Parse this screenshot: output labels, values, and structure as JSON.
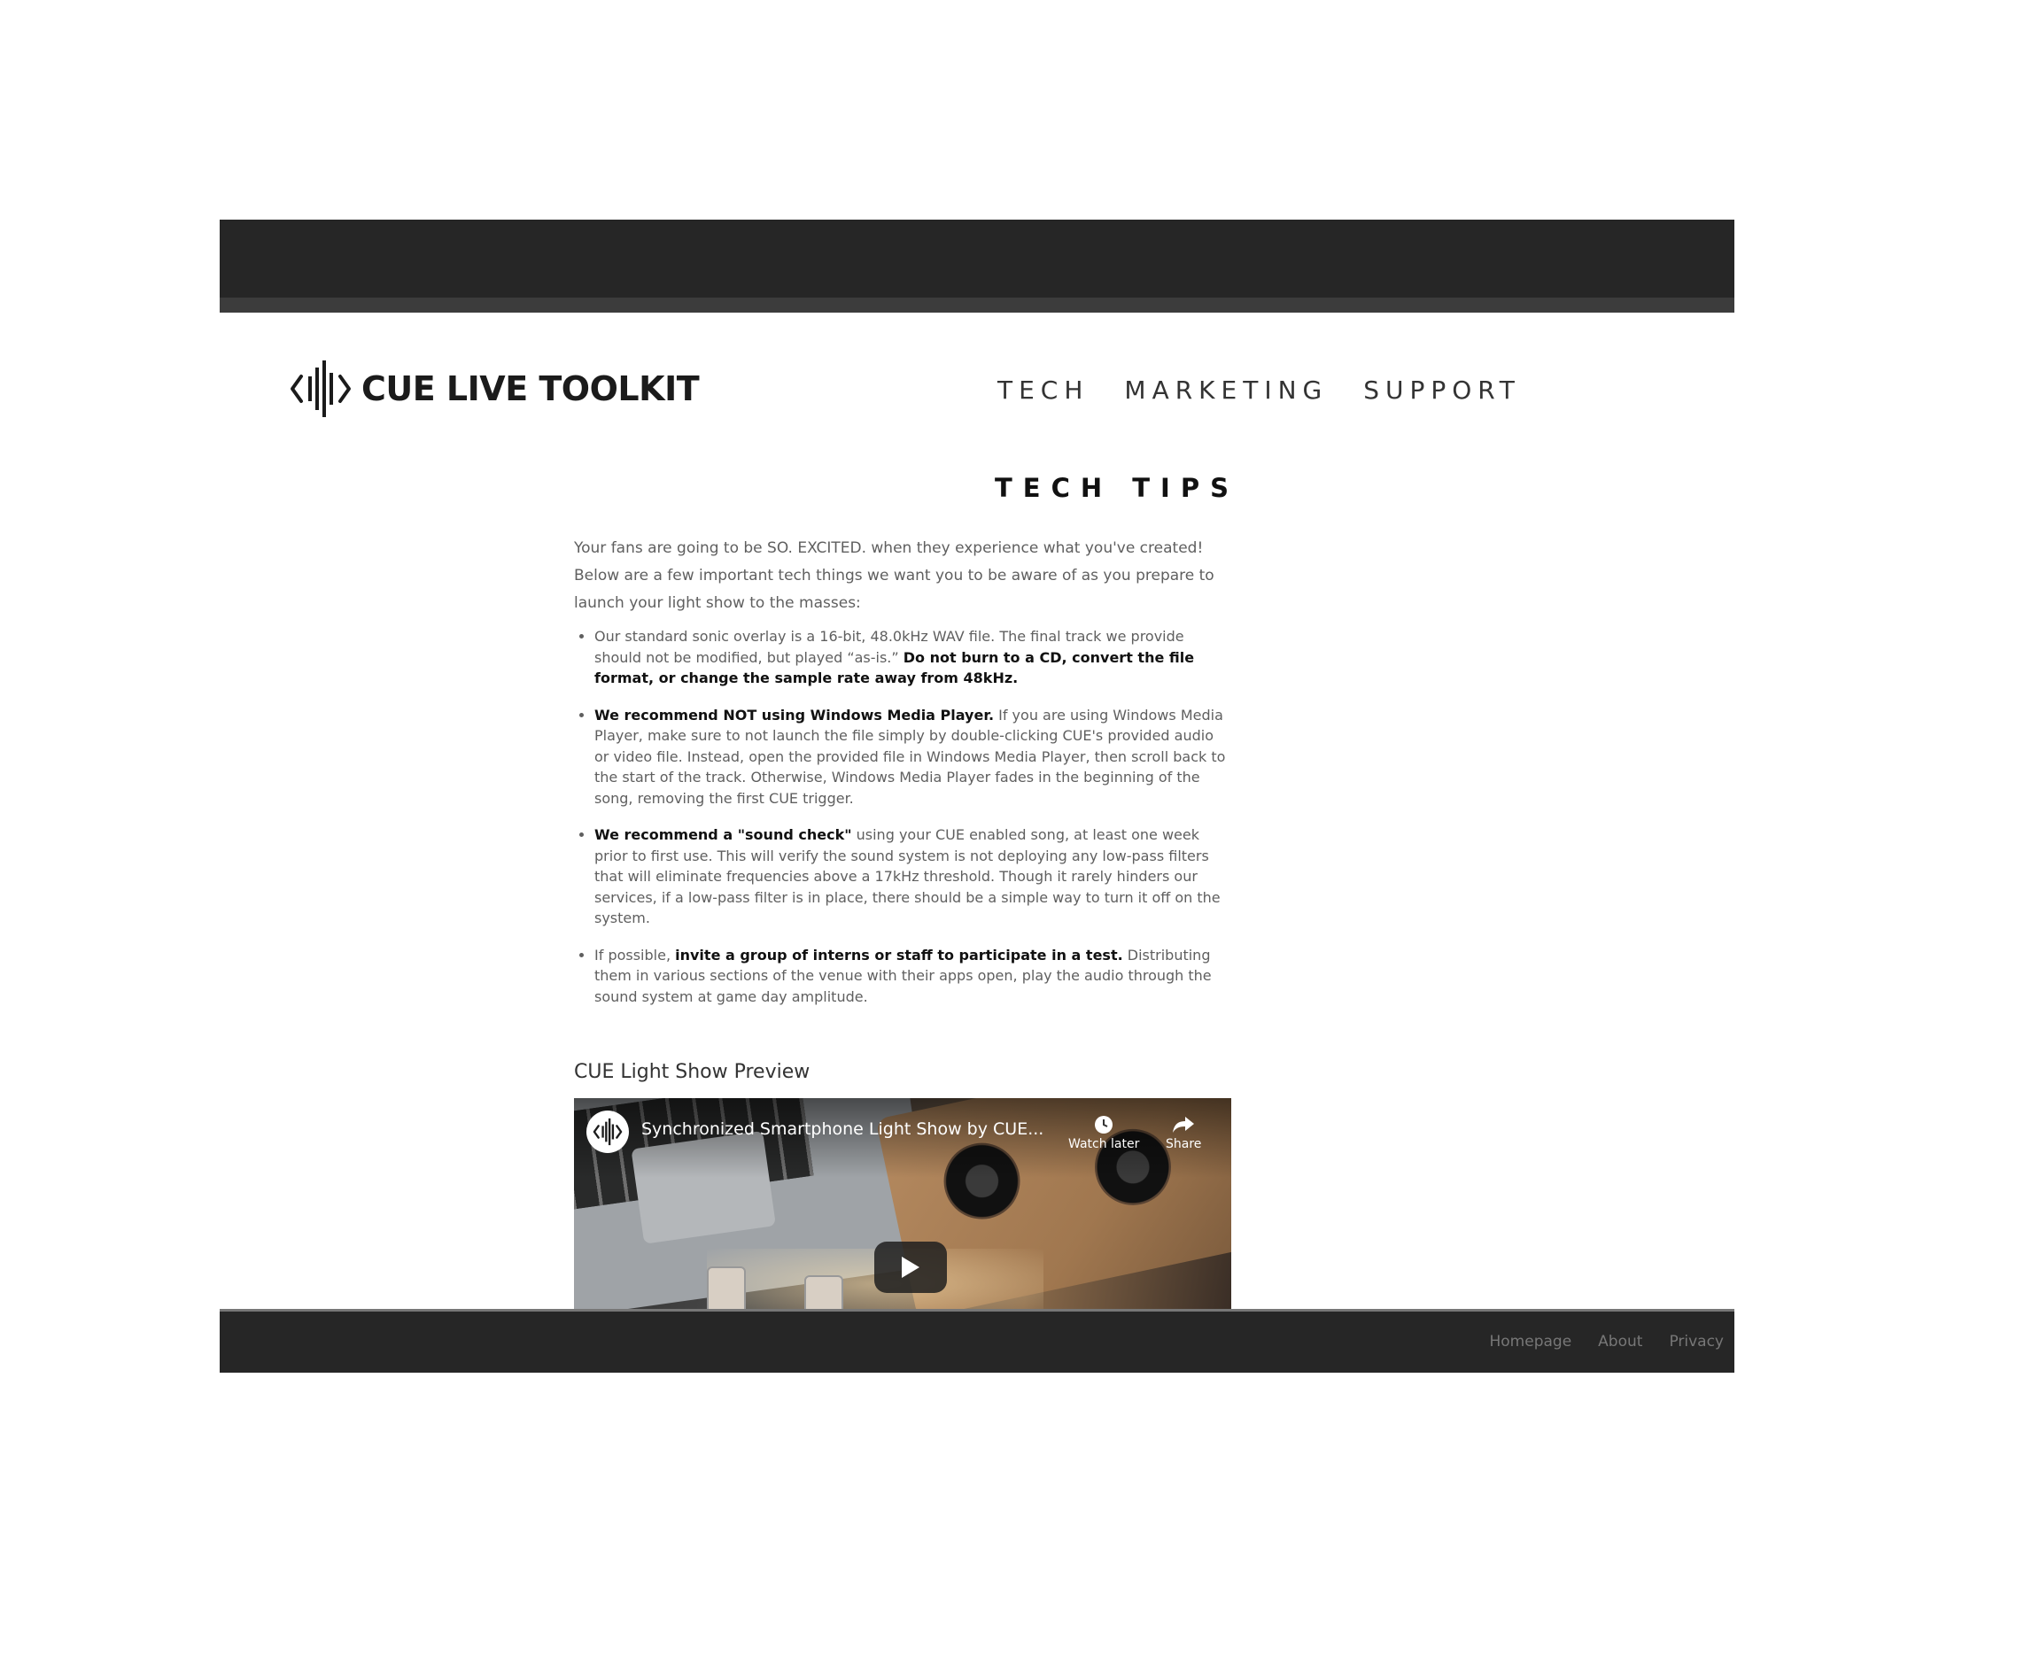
{
  "header": {
    "logo_text": "CUE LIVE TOOLKIT",
    "nav": [
      "TECH",
      "MARKETING",
      "SUPPORT"
    ]
  },
  "main": {
    "title": "TECH TIPS",
    "intro": "Your fans are going to be SO. EXCITED. when they experience what you've created! Below are a few important tech things we want you to be aware of as you prepare to launch your light show to the masses:",
    "tips": [
      {
        "pre": "Our standard sonic overlay is a 16-bit, 48.0kHz WAV file. The final track we provide should not be modified, but played “as-is.” ",
        "bold": "Do not burn to a CD, convert the file format, or change the sample rate away from 48kHz.",
        "post": ""
      },
      {
        "pre": "",
        "bold": "We recommend NOT using Windows Media Player.",
        "post": " If you are using Windows Media Player, make sure to not launch the file simply by double-clicking CUE's provided audio or video file. Instead, open the provided file in Windows Media Player, then scroll back to the start of the track. Otherwise, Windows Media Player fades in the beginning of the song, removing the first CUE trigger."
      },
      {
        "pre": "",
        "bold": "We recommend a \"sound check\"",
        "post": " using your CUE enabled song, at least one week prior to first use. This will verify the sound system is not deploying any low-pass filters that will eliminate frequencies above a 17kHz threshold. Though it rarely hinders our services, if a low-pass filter is in place, there should be a simple way to turn it off on the system."
      },
      {
        "pre": "If possible, ",
        "bold": "invite a group of interns or staff to participate in a test.",
        "post": " Distributing them in various sections of the venue with their apps open, play the audio through the sound system at game day amplitude."
      }
    ],
    "video_heading": "CUE Light Show Preview",
    "video": {
      "title": "Synchronized Smartphone Light Show by CUE...",
      "watch_later": "Watch later",
      "share": "Share"
    }
  },
  "footer": {
    "links": [
      "Homepage",
      "About",
      "Privacy"
    ]
  },
  "colors": {
    "bar": "#262626",
    "text": "#5f5f5f",
    "heading": "#111111"
  }
}
